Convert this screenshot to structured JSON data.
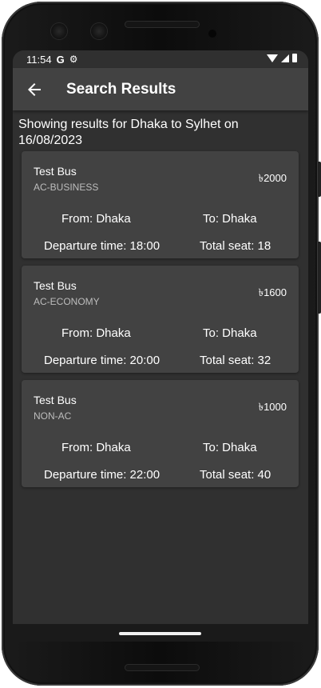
{
  "status_bar": {
    "time": "11:54",
    "google_label": "G",
    "icons": [
      "wifi-icon",
      "signal-icon",
      "battery-icon",
      "gear-icon"
    ]
  },
  "app_bar": {
    "title": "Search Results",
    "back_icon": "arrow-left-icon"
  },
  "summary": {
    "text": "Showing results for Dhaka to Sylhet on 16/08/2023"
  },
  "results": [
    {
      "name": "Test Bus",
      "type": "AC-BUSINESS",
      "price": "৳2000",
      "from": "From: Dhaka",
      "to": "To: Dhaka",
      "departure": "Departure time: 18:00",
      "seats": "Total seat: 18"
    },
    {
      "name": "Test Bus",
      "type": "AC-ECONOMY",
      "price": "৳1600",
      "from": "From: Dhaka",
      "to": "To: Dhaka",
      "departure": "Departure time: 20:00",
      "seats": "Total seat: 32"
    },
    {
      "name": "Test Bus",
      "type": "NON-AC",
      "price": "৳1000",
      "from": "From: Dhaka",
      "to": "To: Dhaka",
      "departure": "Departure time: 22:00",
      "seats": "Total seat: 40"
    }
  ],
  "colors": {
    "background": "#303030",
    "app_bar": "#424242",
    "card": "#424242",
    "text": "#ffffff",
    "subtext": "#bdbdbd"
  }
}
